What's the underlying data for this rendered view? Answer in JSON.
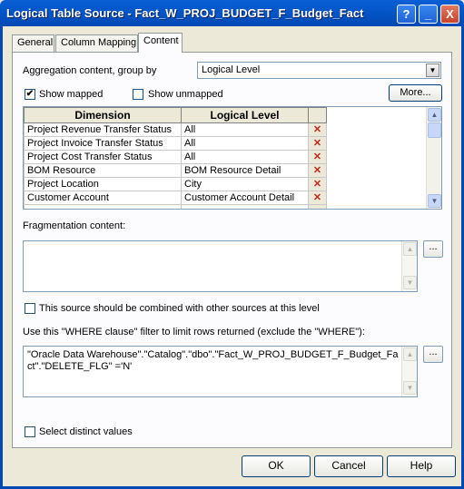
{
  "window": {
    "title": "Logical Table Source - Fact_W_PROJ_BUDGET_F_Budget_Fact",
    "help_button": "?",
    "minimize_button": "_",
    "close_button": "X"
  },
  "tabs": [
    {
      "label": "General"
    },
    {
      "label": "Column Mapping"
    },
    {
      "label": "Content"
    }
  ],
  "content": {
    "aggregation_label": "Aggregation content, group by",
    "aggregation_value": "Logical Level",
    "show_mapped_label": "Show mapped",
    "show_mapped_checked": true,
    "show_unmapped_label": "Show unmapped",
    "show_unmapped_checked": false,
    "more_button": "More...",
    "grid": {
      "headers": [
        "Dimension",
        "Logical Level"
      ],
      "rows": [
        {
          "dimension": "Project Revenue Transfer Status",
          "level": "All"
        },
        {
          "dimension": "Project Invoice Transfer Status",
          "level": "All"
        },
        {
          "dimension": "Project Cost Transfer Status",
          "level": "All"
        },
        {
          "dimension": "BOM Resource",
          "level": "BOM Resource Detail"
        },
        {
          "dimension": "Project Location",
          "level": "City"
        },
        {
          "dimension": "Customer Account",
          "level": "Customer Account Detail"
        }
      ],
      "delete_glyph": "✕"
    },
    "fragmentation_label": "Fragmentation content:",
    "fragmentation_value": "",
    "ellipsis_button": "...",
    "combine_label": "This source should be combined with other sources at this level",
    "combine_checked": false,
    "where_label": "Use this \"WHERE clause\" filter to limit rows returned (exclude the \"WHERE\"):",
    "where_value": "\"Oracle Data Warehouse\".\"Catalog\".\"dbo\".\"Fact_W_PROJ_BUDGET_F_Budget_Fact\".\"DELETE_FLG\" ='N'",
    "distinct_label": "Select distinct values",
    "distinct_checked": false
  },
  "footer": {
    "ok_button": "OK",
    "cancel_button": "Cancel",
    "help_button": "Help"
  },
  "icons": {
    "check": "✔",
    "dropdown_arrow": "▼",
    "scroll_up": "▲",
    "scroll_down": "▼"
  }
}
